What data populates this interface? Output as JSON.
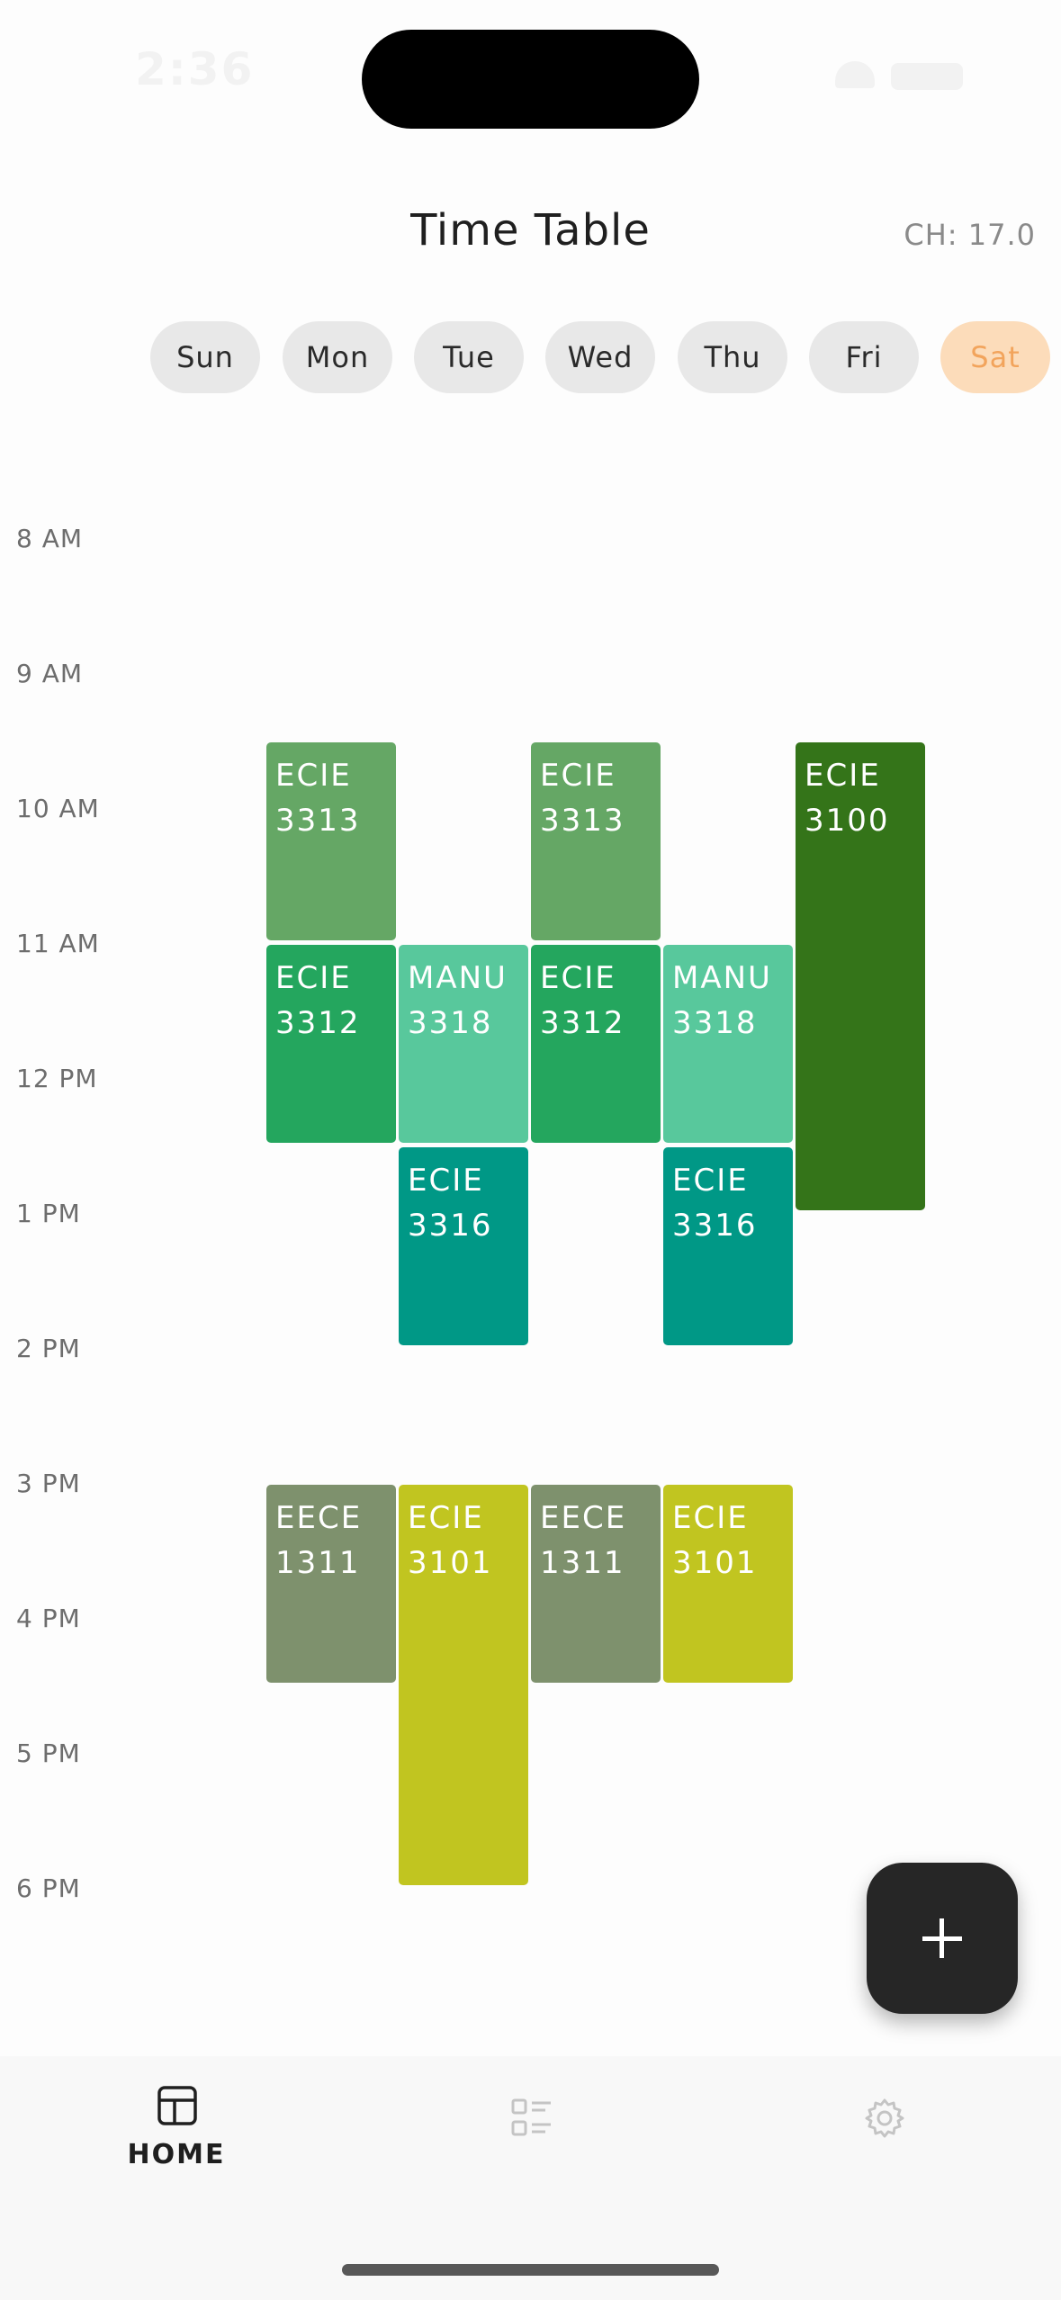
{
  "status_bar": {
    "time": "2:36"
  },
  "header": {
    "title": "Time Table",
    "credit_hours": "CH: 17.0"
  },
  "days": [
    "Sun",
    "Mon",
    "Tue",
    "Wed",
    "Thu",
    "Fri",
    "Sat"
  ],
  "selected_day": "Sat",
  "hours": [
    "8 AM",
    "9 AM",
    "10 AM",
    "11 AM",
    "12 PM",
    "1 PM",
    "2 PM",
    "3 PM",
    "4 PM",
    "5 PM",
    "6 PM"
  ],
  "courses": [
    {
      "code": "ECIE",
      "number": "3313",
      "day": "Mon",
      "start": "9:30",
      "end": "11:00",
      "color": "#65a765"
    },
    {
      "code": "ECIE",
      "number": "3313",
      "day": "Wed",
      "start": "9:30",
      "end": "11:00",
      "color": "#65a765"
    },
    {
      "code": "ECIE",
      "number": "3100",
      "day": "Fri",
      "start": "9:30",
      "end": "13:00",
      "color": "#347419"
    },
    {
      "code": "ECIE",
      "number": "3312",
      "day": "Mon",
      "start": "11:00",
      "end": "12:30",
      "color": "#24a65e"
    },
    {
      "code": "MANU",
      "number": "3318",
      "day": "Tue",
      "start": "11:00",
      "end": "12:30",
      "color": "#58c89c"
    },
    {
      "code": "ECIE",
      "number": "3312",
      "day": "Wed",
      "start": "11:00",
      "end": "12:30",
      "color": "#24a65e"
    },
    {
      "code": "MANU",
      "number": "3318",
      "day": "Thu",
      "start": "11:00",
      "end": "12:30",
      "color": "#58c89c"
    },
    {
      "code": "ECIE",
      "number": "3316",
      "day": "Tue",
      "start": "12:30",
      "end": "14:00",
      "color": "#009886"
    },
    {
      "code": "ECIE",
      "number": "3316",
      "day": "Thu",
      "start": "12:30",
      "end": "14:00",
      "color": "#009886"
    },
    {
      "code": "EECE",
      "number": "1311",
      "day": "Mon",
      "start": "15:00",
      "end": "16:30",
      "color": "#7e916d"
    },
    {
      "code": "ECIE",
      "number": "3101",
      "day": "Tue",
      "start": "15:00",
      "end": "18:00",
      "color": "#c1c520"
    },
    {
      "code": "EECE",
      "number": "1311",
      "day": "Wed",
      "start": "15:00",
      "end": "16:30",
      "color": "#7e916d"
    },
    {
      "code": "ECIE",
      "number": "3101",
      "day": "Thu",
      "start": "15:00",
      "end": "16:30",
      "color": "#c1c520"
    }
  ],
  "fab": {
    "icon": "plus-icon"
  },
  "bottom_nav": [
    {
      "label": "HOME",
      "icon": "grid-icon",
      "active": true
    },
    {
      "label": "",
      "icon": "list-icon",
      "active": false
    },
    {
      "label": "",
      "icon": "gear-icon",
      "active": false
    }
  ]
}
